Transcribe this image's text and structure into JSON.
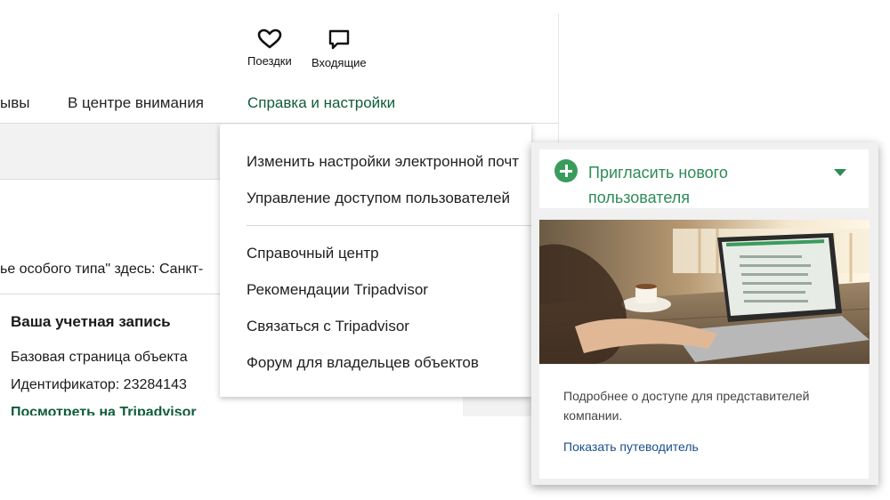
{
  "header": {
    "trips_label": "Поездки",
    "inbox_label": "Входящие"
  },
  "nav": {
    "reviews_partial": "ывы",
    "highlights": "В центре внимания",
    "help_settings": "Справка и настройки"
  },
  "main": {
    "clipped_text": "ье особого типа\" здесь: Санкт-"
  },
  "menu": {
    "email_settings": "Изменить настройки электронной почт",
    "user_access": "Управление доступом пользователей",
    "help_center": "Справочный центр",
    "recommendations": "Рекомендации Tripadvisor",
    "contact": "Связаться с Tripadvisor",
    "owners_forum": "Форум для владельцев объектов"
  },
  "account": {
    "title": "Ваша учетная запись",
    "page_type": "Базовая страница объекта",
    "id_line": "Идентификатор: 23284143",
    "view_link": "Посмотреть на Tripadvisor"
  },
  "invite_card": {
    "title": "Пригласить нового пользователя",
    "description": "Подробнее о доступе для представителей компании.",
    "guide_link": "Показать путеводитель",
    "accent_color": "#2e8b57"
  },
  "icons": {
    "trips": "heart-icon",
    "inbox": "speech-bubble-icon",
    "invite": "plus-circle-icon",
    "expand": "caret-down-icon"
  }
}
